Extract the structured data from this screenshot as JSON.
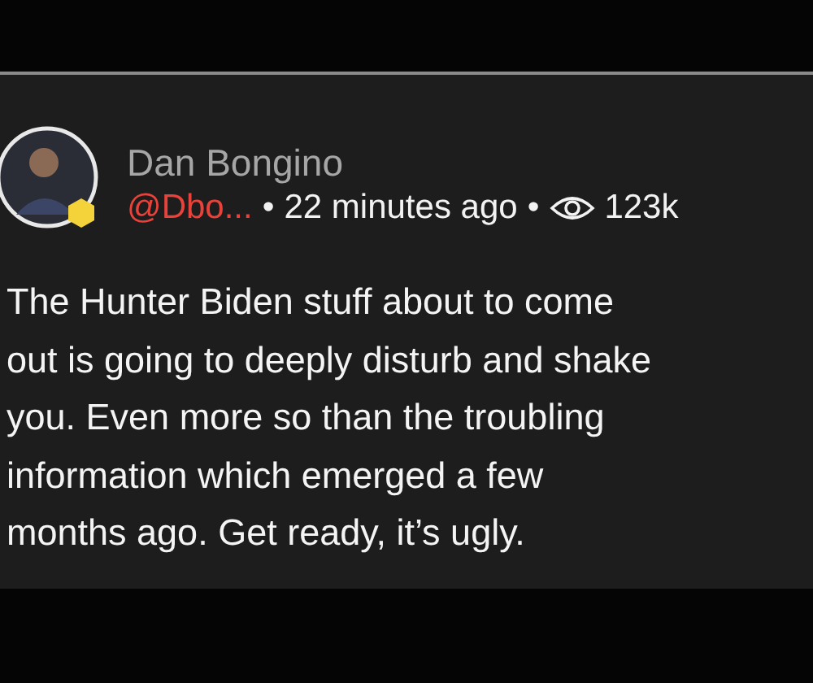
{
  "post": {
    "author": "Dan Bongino",
    "handle": "@Dbo...",
    "separator_1": "•",
    "time": "22 minutes ago",
    "separator_2": "•",
    "views": "123k",
    "body_lines": [
      "The Hunter Biden stuff about to come",
      "out is going to deeply disturb and shake",
      "you. Even more so than the troubling",
      "information which emerged a few",
      "months ago. Get ready, it’s ugly."
    ]
  }
}
